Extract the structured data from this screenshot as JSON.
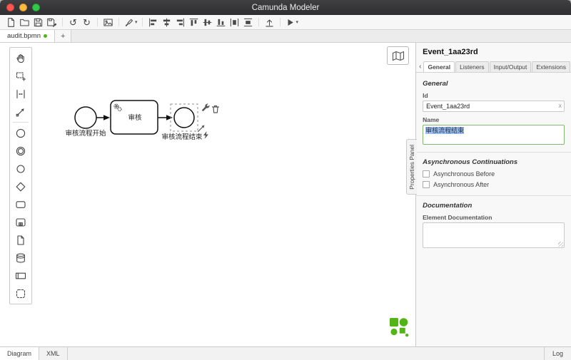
{
  "window": {
    "title": "Camunda Modeler"
  },
  "toolbar": {
    "icons": [
      "new-diagram",
      "open-file",
      "save",
      "save-as",
      "undo",
      "redo",
      "export-image",
      "element-template",
      "align-left",
      "align-center",
      "align-right",
      "align-top",
      "align-middle",
      "align-bottom",
      "distribute-horizontally",
      "distribute-vertically",
      "deploy",
      "run-process"
    ]
  },
  "document_tabs": {
    "active": "audit.bpmn",
    "new_tab": "+"
  },
  "palette": {
    "icons": [
      "hand-tool",
      "lasso-tool",
      "space-tool",
      "global-connect-tool",
      "create-start-event",
      "create-intermediate-event",
      "create-end-event",
      "create-gateway",
      "create-task",
      "create-subprocess",
      "create-data-object",
      "create-data-store",
      "create-participant",
      "create-group"
    ]
  },
  "canvas": {
    "start_event_label": "审核流程开始",
    "task_label": "审核",
    "end_event_label": "审核流程结束",
    "context_pad": [
      "change-type-wrench",
      "delete-trash",
      "connect-tool",
      "append-text-annotation"
    ],
    "logo_color": "#52b415"
  },
  "properties": {
    "header": "Event_1aa23rd",
    "tabs_scroll_left": "‹",
    "tabs": [
      "General",
      "Listeners",
      "Input/Output",
      "Extensions"
    ],
    "active_tab": "General",
    "general": {
      "title": "General",
      "id_label": "Id",
      "id_value": "Event_1aa23rd",
      "clear": "x",
      "name_label": "Name",
      "name_value": "审核流程结束"
    },
    "async": {
      "title": "Asynchronous Continuations",
      "before_label": "Asynchronous Before",
      "after_label": "Asynchronous After"
    },
    "documentation": {
      "title": "Documentation",
      "label": "Element Documentation"
    },
    "vertical_tab": "Properties Panel",
    "focus_border_color": "#84b773",
    "selection_color": "#9ac1f7"
  },
  "statusbar": {
    "diagram": "Diagram",
    "xml": "XML",
    "log": "Log"
  }
}
